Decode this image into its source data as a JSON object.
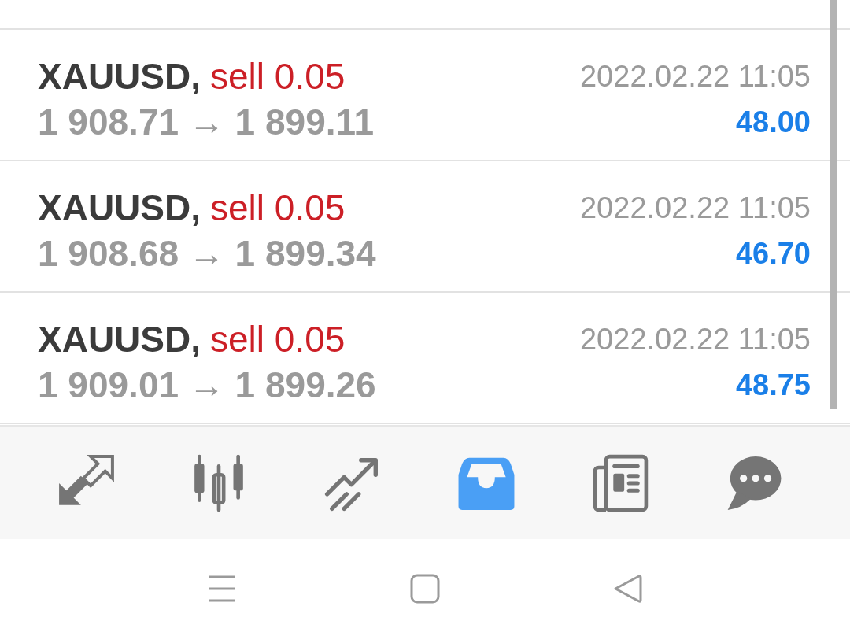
{
  "trades": [
    {
      "symbol": "XAUUSD,",
      "order": "sell 0.05",
      "prices": "1 908.71 → 1 899.11",
      "time": "2022.02.22 11:05",
      "profit": "48.00"
    },
    {
      "symbol": "XAUUSD,",
      "order": "sell 0.05",
      "prices": "1 908.68 → 1 899.34",
      "time": "2022.02.22 11:05",
      "profit": "46.70"
    },
    {
      "symbol": "XAUUSD,",
      "order": "sell 0.05",
      "prices": "1 909.01 → 1 899.26",
      "time": "2022.02.22 11:05",
      "profit": "48.75"
    }
  ],
  "toolbar": [
    {
      "kind": "quotes",
      "selected": false
    },
    {
      "kind": "chart",
      "selected": false
    },
    {
      "kind": "trade",
      "selected": false
    },
    {
      "kind": "history",
      "selected": true
    },
    {
      "kind": "news",
      "selected": false
    },
    {
      "kind": "chat",
      "selected": false
    }
  ]
}
